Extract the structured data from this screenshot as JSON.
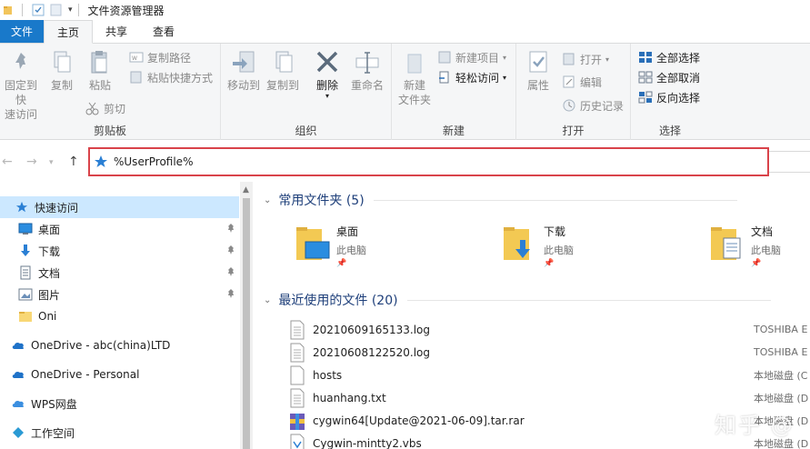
{
  "window": {
    "title": "文件资源管理器"
  },
  "tabs": [
    {
      "label": "文件"
    },
    {
      "label": "主页"
    },
    {
      "label": "共享"
    },
    {
      "label": "查看"
    }
  ],
  "ribbon": {
    "clipboard": {
      "label": "剪贴板",
      "pin": "固定到快\n速访问",
      "copy": "复制",
      "paste": "粘贴",
      "copy_path": "复制路径",
      "paste_shortcut": "粘贴快捷方式",
      "cut": "剪切"
    },
    "organize": {
      "label": "组织",
      "move_to": "移动到",
      "copy_to": "复制到",
      "delete": "删除",
      "rename": "重命名"
    },
    "new": {
      "label": "新建",
      "new_folder": "新建\n文件夹",
      "new_item": "新建项目",
      "easy_access": "轻松访问"
    },
    "open": {
      "label": "打开",
      "properties": "属性",
      "open": "打开",
      "edit": "编辑",
      "history": "历史记录"
    },
    "select": {
      "label": "选择",
      "select_all": "全部选择",
      "select_none": "全部取消",
      "invert": "反向选择"
    }
  },
  "address": {
    "value": "%UserProfile%"
  },
  "nav": {
    "items": [
      {
        "label": "快速访问",
        "icon": "star-icon"
      },
      {
        "label": "桌面",
        "icon": "desktop-icon",
        "pinned": true
      },
      {
        "label": "下载",
        "icon": "download-icon",
        "pinned": true
      },
      {
        "label": "文档",
        "icon": "documents-icon",
        "pinned": true
      },
      {
        "label": "图片",
        "icon": "pictures-icon",
        "pinned": true
      },
      {
        "label": "Oni",
        "icon": "folder-icon"
      },
      {
        "label": "OneDrive - abc(china)LTD",
        "icon": "cloud-icon"
      },
      {
        "label": "OneDrive - Personal",
        "icon": "cloud-icon"
      },
      {
        "label": "WPS网盘",
        "icon": "wps-cloud-icon"
      },
      {
        "label": "工作空间",
        "icon": "workspace-icon"
      }
    ]
  },
  "frequent": {
    "header": "常用文件夹 (5)",
    "items": [
      {
        "name": "桌面",
        "location": "此电脑"
      },
      {
        "name": "下载",
        "location": "此电脑"
      },
      {
        "name": "文档",
        "location": "此电脑"
      }
    ]
  },
  "recent": {
    "header": "最近使用的文件 (20)",
    "items": [
      {
        "name": "20210609165133.log",
        "location": "TOSHIBA E"
      },
      {
        "name": "20210608122520.log",
        "location": "TOSHIBA E"
      },
      {
        "name": "hosts",
        "location": "本地磁盘 (C"
      },
      {
        "name": "huanhang.txt",
        "location": "本地磁盘 (D"
      },
      {
        "name": "cygwin64[Update@2021-06-09].tar.rar",
        "location": "本地磁盘 (D"
      },
      {
        "name": "Cygwin-mintty2.vbs",
        "location": "本地磁盘 (D"
      }
    ]
  },
  "watermark": "知乎 @",
  "colors": {
    "accent": "#1979ca",
    "highlight": "#d9434a",
    "selection": "#cce8ff"
  }
}
